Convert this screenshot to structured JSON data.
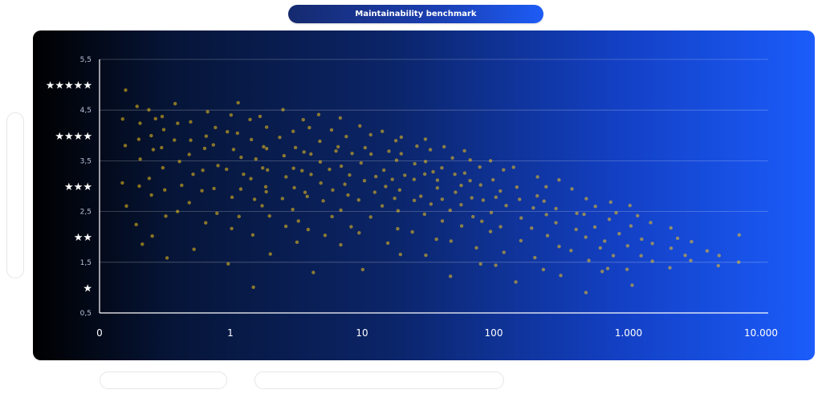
{
  "header": {
    "title": "Maintainability benchmark"
  },
  "chart_data": {
    "type": "scatter",
    "title": "Maintainability benchmark",
    "xlabel": "",
    "ylabel": "",
    "x_scale": "log",
    "x_ticks": [
      {
        "value": 0,
        "label": "0"
      },
      {
        "value": 1,
        "label": "1"
      },
      {
        "value": 10,
        "label": "10"
      },
      {
        "value": 100,
        "label": "100"
      },
      {
        "value": 1000,
        "label": "1.000"
      },
      {
        "value": 10000,
        "label": "10.000"
      }
    ],
    "y_ticks": [
      {
        "value": 0.5,
        "label": "0,5"
      },
      {
        "value": 1.5,
        "label": "1,5"
      },
      {
        "value": 2.5,
        "label": "2,5"
      },
      {
        "value": 3.5,
        "label": "3,5"
      },
      {
        "value": 4.5,
        "label": "4,5"
      },
      {
        "value": 5.5,
        "label": "5,5"
      }
    ],
    "ylim": [
      0.5,
      5.5
    ],
    "xlim": [
      0,
      10000
    ],
    "star_ratings": [
      {
        "label": "★★★★★",
        "y": 5.0
      },
      {
        "label": "★★★★",
        "y": 4.0
      },
      {
        "label": "★★★",
        "y": 3.0
      },
      {
        "label": "★★",
        "y": 2.0
      },
      {
        "label": "★",
        "y": 1.0
      }
    ],
    "grid": true,
    "point_color": "#f5c518",
    "series": [
      {
        "points": [
          [
            0.2,
            4.9
          ],
          [
            0.2,
            4.3
          ],
          [
            0.2,
            3.8
          ],
          [
            0.2,
            3.1
          ],
          [
            0.2,
            2.6
          ],
          [
            0.3,
            4.6
          ],
          [
            0.3,
            4.2
          ],
          [
            0.3,
            3.9
          ],
          [
            0.3,
            3.5
          ],
          [
            0.3,
            3.0
          ],
          [
            0.3,
            2.2
          ],
          [
            0.3,
            1.9
          ],
          [
            0.4,
            4.5
          ],
          [
            0.4,
            4.3
          ],
          [
            0.4,
            4.0
          ],
          [
            0.4,
            3.7
          ],
          [
            0.4,
            3.2
          ],
          [
            0.4,
            2.8
          ],
          [
            0.4,
            2.0
          ],
          [
            0.5,
            4.4
          ],
          [
            0.5,
            4.1
          ],
          [
            0.5,
            3.8
          ],
          [
            0.5,
            3.4
          ],
          [
            0.5,
            2.9
          ],
          [
            0.5,
            2.4
          ],
          [
            0.5,
            1.6
          ],
          [
            0.6,
            4.6
          ],
          [
            0.6,
            4.2
          ],
          [
            0.6,
            3.9
          ],
          [
            0.6,
            3.5
          ],
          [
            0.6,
            3.0
          ],
          [
            0.6,
            2.5
          ],
          [
            0.7,
            4.3
          ],
          [
            0.7,
            3.9
          ],
          [
            0.7,
            3.6
          ],
          [
            0.7,
            3.2
          ],
          [
            0.7,
            2.7
          ],
          [
            0.7,
            1.8
          ],
          [
            0.8,
            4.5
          ],
          [
            0.8,
            4.0
          ],
          [
            0.8,
            3.7
          ],
          [
            0.8,
            3.3
          ],
          [
            0.8,
            2.9
          ],
          [
            0.8,
            2.3
          ],
          [
            0.9,
            4.2
          ],
          [
            0.9,
            3.8
          ],
          [
            0.9,
            3.4
          ],
          [
            0.9,
            3.0
          ],
          [
            0.9,
            2.5
          ],
          [
            1.0,
            4.4
          ],
          [
            1.0,
            4.1
          ],
          [
            1.0,
            3.7
          ],
          [
            1.0,
            3.3
          ],
          [
            1.0,
            2.8
          ],
          [
            1.0,
            2.2
          ],
          [
            1.0,
            1.5
          ],
          [
            1.2,
            4.6
          ],
          [
            1.2,
            4.0
          ],
          [
            1.2,
            3.6
          ],
          [
            1.2,
            3.2
          ],
          [
            1.2,
            2.9
          ],
          [
            1.2,
            2.4
          ],
          [
            1.5,
            4.3
          ],
          [
            1.5,
            3.9
          ],
          [
            1.5,
            3.5
          ],
          [
            1.5,
            3.1
          ],
          [
            1.5,
            2.7
          ],
          [
            1.5,
            2.0
          ],
          [
            1.5,
            1.0
          ],
          [
            1.8,
            4.4
          ],
          [
            1.8,
            3.8
          ],
          [
            1.8,
            3.4
          ],
          [
            1.8,
            3.0
          ],
          [
            1.8,
            2.6
          ],
          [
            2.0,
            4.2
          ],
          [
            2.0,
            3.7
          ],
          [
            2.0,
            3.3
          ],
          [
            2.0,
            2.9
          ],
          [
            2.0,
            2.4
          ],
          [
            2.0,
            1.7
          ],
          [
            2.5,
            4.5
          ],
          [
            2.5,
            4.0
          ],
          [
            2.5,
            3.6
          ],
          [
            2.5,
            3.2
          ],
          [
            2.5,
            2.8
          ],
          [
            2.5,
            2.2
          ],
          [
            3.0,
            4.1
          ],
          [
            3.0,
            3.8
          ],
          [
            3.0,
            3.4
          ],
          [
            3.0,
            3.0
          ],
          [
            3.0,
            2.5
          ],
          [
            3.0,
            1.9
          ],
          [
            3.5,
            4.3
          ],
          [
            3.5,
            3.7
          ],
          [
            3.5,
            3.3
          ],
          [
            3.5,
            2.9
          ],
          [
            3.5,
            2.3
          ],
          [
            4.0,
            4.2
          ],
          [
            4.0,
            3.6
          ],
          [
            4.0,
            3.2
          ],
          [
            4.0,
            2.8
          ],
          [
            4.0,
            2.1
          ],
          [
            4.0,
            1.3
          ],
          [
            5.0,
            4.4
          ],
          [
            5.0,
            3.9
          ],
          [
            5.0,
            3.5
          ],
          [
            5.0,
            3.1
          ],
          [
            5.0,
            2.7
          ],
          [
            5.0,
            2.0
          ],
          [
            6.0,
            4.1
          ],
          [
            6.0,
            3.7
          ],
          [
            6.0,
            3.3
          ],
          [
            6.0,
            2.9
          ],
          [
            6.0,
            2.4
          ],
          [
            7.0,
            4.3
          ],
          [
            7.0,
            3.8
          ],
          [
            7.0,
            3.4
          ],
          [
            7.0,
            3.0
          ],
          [
            7.0,
            2.5
          ],
          [
            7.0,
            1.8
          ],
          [
            8.0,
            4.0
          ],
          [
            8.0,
            3.6
          ],
          [
            8.0,
            3.2
          ],
          [
            8.0,
            2.8
          ],
          [
            8.0,
            2.2
          ],
          [
            10,
            4.2
          ],
          [
            10,
            3.8
          ],
          [
            10,
            3.5
          ],
          [
            10,
            3.1
          ],
          [
            10,
            2.7
          ],
          [
            10,
            2.1
          ],
          [
            10,
            1.4
          ],
          [
            12,
            4.0
          ],
          [
            12,
            3.6
          ],
          [
            12,
            3.2
          ],
          [
            12,
            2.9
          ],
          [
            12,
            2.4
          ],
          [
            15,
            4.1
          ],
          [
            15,
            3.7
          ],
          [
            15,
            3.3
          ],
          [
            15,
            3.0
          ],
          [
            15,
            2.6
          ],
          [
            15,
            1.9
          ],
          [
            18,
            3.9
          ],
          [
            18,
            3.5
          ],
          [
            18,
            3.1
          ],
          [
            18,
            2.8
          ],
          [
            18,
            2.2
          ],
          [
            20,
            4.0
          ],
          [
            20,
            3.6
          ],
          [
            20,
            3.2
          ],
          [
            20,
            2.9
          ],
          [
            20,
            2.5
          ],
          [
            20,
            1.7
          ],
          [
            25,
            3.8
          ],
          [
            25,
            3.4
          ],
          [
            25,
            3.1
          ],
          [
            25,
            2.7
          ],
          [
            25,
            2.1
          ],
          [
            30,
            3.9
          ],
          [
            30,
            3.5
          ],
          [
            30,
            3.2
          ],
          [
            30,
            2.8
          ],
          [
            30,
            2.4
          ],
          [
            30,
            1.6
          ],
          [
            35,
            3.7
          ],
          [
            35,
            3.3
          ],
          [
            35,
            3.0
          ],
          [
            35,
            2.6
          ],
          [
            35,
            2.0
          ],
          [
            40,
            3.8
          ],
          [
            40,
            3.4
          ],
          [
            40,
            3.1
          ],
          [
            40,
            2.7
          ],
          [
            40,
            2.3
          ],
          [
            50,
            3.6
          ],
          [
            50,
            3.2
          ],
          [
            50,
            2.9
          ],
          [
            50,
            2.5
          ],
          [
            50,
            1.9
          ],
          [
            50,
            1.2
          ],
          [
            60,
            3.7
          ],
          [
            60,
            3.3
          ],
          [
            60,
            3.0
          ],
          [
            60,
            2.6
          ],
          [
            60,
            2.2
          ],
          [
            70,
            3.5
          ],
          [
            70,
            3.1
          ],
          [
            70,
            2.8
          ],
          [
            70,
            2.4
          ],
          [
            70,
            1.8
          ],
          [
            80,
            3.4
          ],
          [
            80,
            3.0
          ],
          [
            80,
            2.7
          ],
          [
            80,
            2.3
          ],
          [
            80,
            1.5
          ],
          [
            100,
            3.5
          ],
          [
            100,
            3.1
          ],
          [
            100,
            2.8
          ],
          [
            100,
            2.5
          ],
          [
            100,
            2.1
          ],
          [
            100,
            1.4
          ],
          [
            120,
            3.3
          ],
          [
            120,
            2.9
          ],
          [
            120,
            2.6
          ],
          [
            120,
            2.2
          ],
          [
            120,
            1.7
          ],
          [
            150,
            3.4
          ],
          [
            150,
            3.0
          ],
          [
            150,
            2.7
          ],
          [
            150,
            2.4
          ],
          [
            150,
            1.9
          ],
          [
            150,
            1.1
          ],
          [
            200,
            3.2
          ],
          [
            200,
            2.8
          ],
          [
            200,
            2.6
          ],
          [
            200,
            2.2
          ],
          [
            200,
            1.6
          ],
          [
            250,
            3.0
          ],
          [
            250,
            2.7
          ],
          [
            250,
            2.4
          ],
          [
            250,
            2.0
          ],
          [
            250,
            1.4
          ],
          [
            300,
            3.1
          ],
          [
            300,
            2.6
          ],
          [
            300,
            2.3
          ],
          [
            300,
            1.8
          ],
          [
            300,
            1.2
          ],
          [
            400,
            2.9
          ],
          [
            400,
            2.5
          ],
          [
            400,
            2.1
          ],
          [
            400,
            1.7
          ],
          [
            500,
            2.8
          ],
          [
            500,
            2.4
          ],
          [
            500,
            2.0
          ],
          [
            500,
            1.5
          ],
          [
            500,
            0.9
          ],
          [
            600,
            2.6
          ],
          [
            600,
            2.2
          ],
          [
            600,
            1.8
          ],
          [
            600,
            1.3
          ],
          [
            700,
            2.7
          ],
          [
            700,
            2.3
          ],
          [
            700,
            1.9
          ],
          [
            700,
            1.4
          ],
          [
            800,
            2.5
          ],
          [
            800,
            2.1
          ],
          [
            800,
            1.6
          ],
          [
            1000,
            2.6
          ],
          [
            1000,
            2.2
          ],
          [
            1000,
            1.8
          ],
          [
            1000,
            1.4
          ],
          [
            1000,
            1.0
          ],
          [
            1200,
            2.4
          ],
          [
            1200,
            2.0
          ],
          [
            1200,
            1.6
          ],
          [
            1500,
            2.3
          ],
          [
            1500,
            1.9
          ],
          [
            1500,
            1.5
          ],
          [
            2000,
            2.2
          ],
          [
            2000,
            1.8
          ],
          [
            2000,
            1.4
          ],
          [
            2500,
            2.0
          ],
          [
            2500,
            1.6
          ],
          [
            3000,
            1.9
          ],
          [
            3000,
            1.5
          ],
          [
            4000,
            1.7
          ],
          [
            5000,
            1.6
          ],
          [
            5000,
            1.4
          ],
          [
            7000,
            1.5
          ],
          [
            7000,
            2.0
          ]
        ]
      }
    ]
  }
}
